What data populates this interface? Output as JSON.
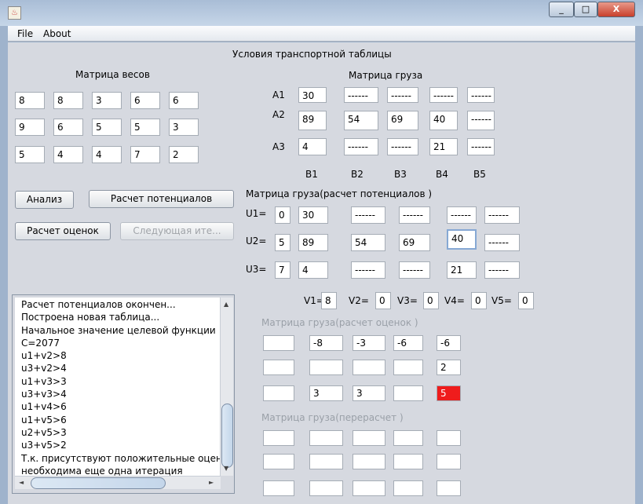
{
  "window": {
    "close": "X",
    "min": "_",
    "max": "□",
    "icon": "java-icon"
  },
  "menu": [
    "File",
    "About"
  ],
  "header": "Условия транспортной таблицы",
  "weights": {
    "title": "Матрица весов",
    "rows": [
      [
        "8",
        "8",
        "3",
        "6",
        "6"
      ],
      [
        "9",
        "6",
        "5",
        "5",
        "3"
      ],
      [
        "5",
        "4",
        "4",
        "7",
        "2"
      ]
    ]
  },
  "cargo": {
    "title": "Матрица груза",
    "row_labels": [
      "A1",
      "A2",
      "A3"
    ],
    "col_labels": [
      "B1",
      "B2",
      "B3",
      "B4",
      "B5"
    ],
    "rows": [
      [
        "30",
        "------",
        "------",
        "------",
        "------"
      ],
      [
        "89",
        "54",
        "69",
        "40",
        "------"
      ],
      [
        "4",
        "------",
        "------",
        "21",
        "------"
      ]
    ]
  },
  "buttons": {
    "analyze": "Анализ",
    "potentials": "Расчет потенциалов",
    "estimates": "Расчет оценок",
    "next": "Следующая ите..."
  },
  "potentials": {
    "title": "Матрица груза(расчет потенциалов )",
    "u_labels": [
      "U1=",
      "U2=",
      "U3="
    ],
    "u_values": [
      "0",
      "5",
      "7"
    ],
    "rows": [
      [
        "30",
        "------",
        "------",
        "------",
        "------"
      ],
      [
        "89",
        "54",
        "69",
        "40",
        "------"
      ],
      [
        "4",
        "------",
        "------",
        "21",
        "------"
      ]
    ],
    "v_labels": [
      "V1=",
      "V2=",
      "V3=",
      "V4=",
      "V5="
    ],
    "v_values": [
      "8",
      "0",
      "0",
      "0",
      "0"
    ]
  },
  "estimates": {
    "title": "Матрица груза(расчет оценок )",
    "rows": [
      [
        "",
        "-8",
        "-3",
        "-6",
        "-6"
      ],
      [
        "",
        "",
        "",
        "",
        "2"
      ],
      [
        "",
        "3",
        "3",
        "",
        "5"
      ]
    ],
    "highlight_color": "#ef1c1c"
  },
  "recount": {
    "title": "Матрица груза(перерасчет )",
    "rows": [
      [
        "",
        "",
        "",
        "",
        ""
      ],
      [
        "",
        "",
        "",
        "",
        ""
      ],
      [
        "",
        "",
        "",
        "",
        ""
      ]
    ]
  },
  "log": [
    "Расчет потенциалов окончен...",
    "Построена новая таблица...",
    "Начальное значение целевой функции",
    "C=2077",
    "u1+v2>8",
    "u3+v2>4",
    "u1+v3>3",
    "u3+v3>4",
    "u1+v4>6",
    "u1+v5>6",
    "u2+v5>3",
    "u3+v5>2",
    "Т.к. присутствуют положительные оцен",
    "необходима еще одна итерация"
  ]
}
